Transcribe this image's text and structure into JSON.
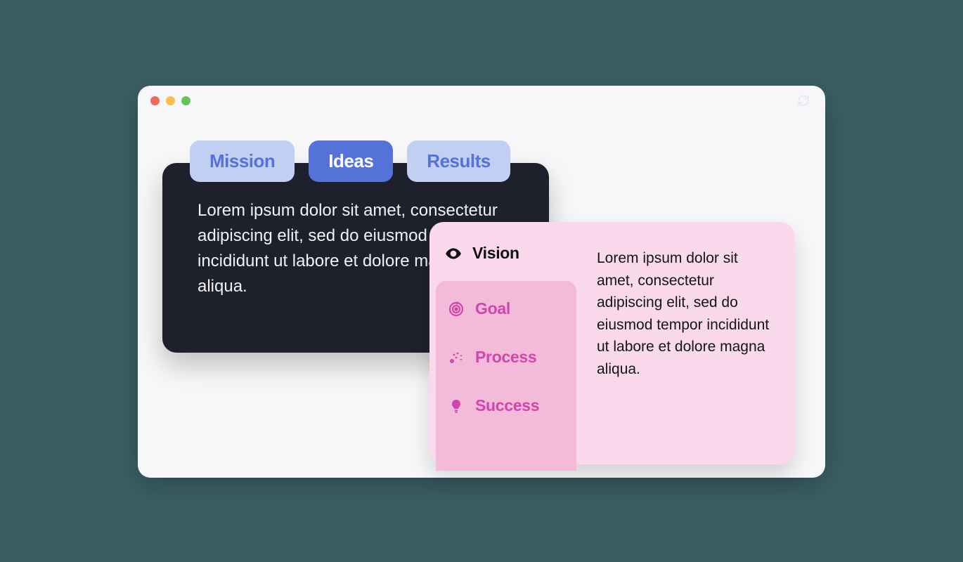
{
  "colors": {
    "page_bg": "#3a5f63",
    "window_bg": "#f7f6f8",
    "tab_bg": "#c1cff3",
    "tab_active_bg": "#5572d9",
    "tab_text": "#5572d9",
    "tab_active_text": "#ffffff",
    "card_dark_bg": "#1e212c",
    "card_pink_bg": "#fad9ed",
    "card_pink_inner_bg": "#f3bada",
    "pink_accent": "#d046ad"
  },
  "traffic": {
    "red": "#ed6a5e",
    "yellow": "#f5bf4f",
    "green": "#62c554"
  },
  "tabs": [
    {
      "label": "Mission"
    },
    {
      "label": "Ideas"
    },
    {
      "label": "Results"
    }
  ],
  "tabs_active_index": 1,
  "card1": {
    "text": "Lorem ipsum dolor sit amet, consectetur adipiscing elit, sed do eiusmod tempor incididunt ut labore et dolore magna aliqua."
  },
  "card2": {
    "items": [
      {
        "icon": "eye-icon",
        "label": "Vision"
      },
      {
        "icon": "target-icon",
        "label": "Goal"
      },
      {
        "icon": "process-icon",
        "label": "Process"
      },
      {
        "icon": "lightbulb-icon",
        "label": "Success"
      }
    ],
    "active_index": 0,
    "content": "Lorem ipsum dolor sit amet, consectetur adipiscing elit, sed do eiusmod tempor incididunt ut labore et dolore magna aliqua."
  }
}
